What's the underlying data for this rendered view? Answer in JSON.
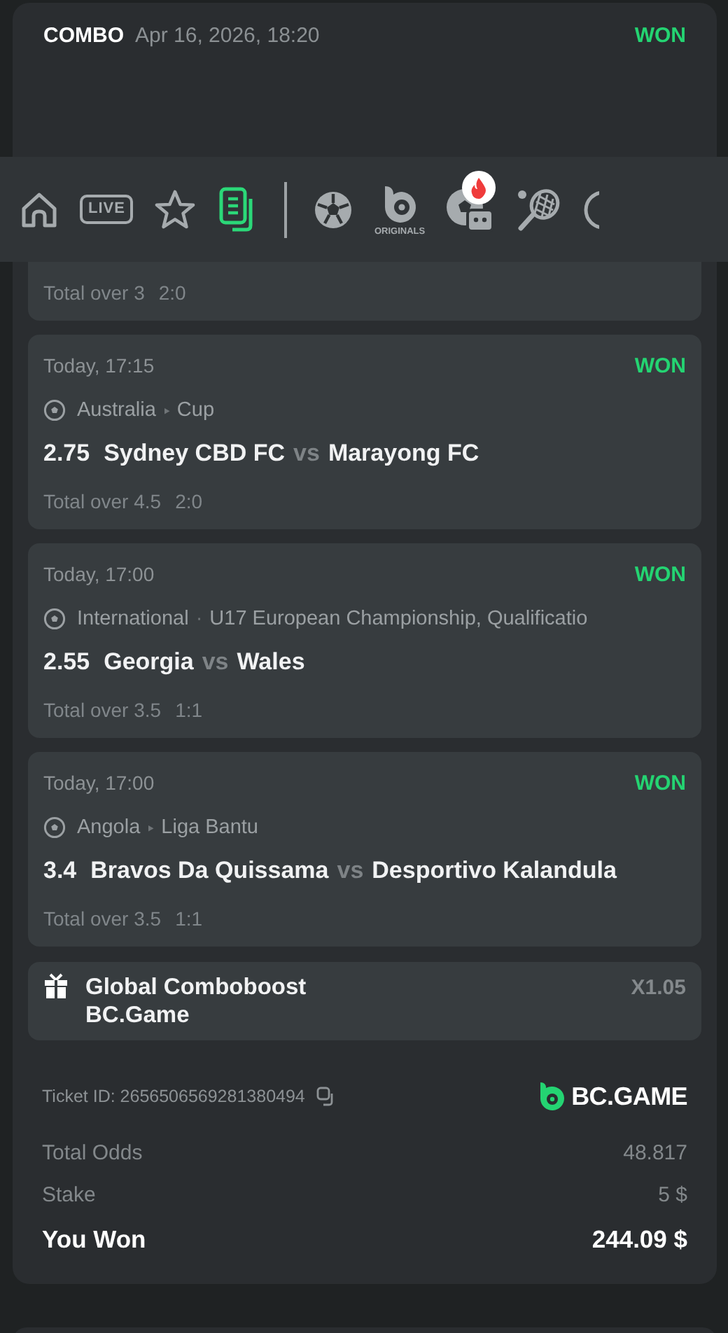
{
  "header": {
    "type": "COMBO",
    "date": "Apr 16, 2026, 18:20",
    "status": "WON"
  },
  "nav": {
    "items": [
      {
        "kind": "home",
        "selected": false
      },
      {
        "kind": "live",
        "label": "LIVE",
        "selected": false
      },
      {
        "kind": "favorites",
        "selected": false
      },
      {
        "kind": "bets",
        "selected": true
      },
      {
        "kind": "divider"
      },
      {
        "kind": "soccer",
        "selected": false
      },
      {
        "kind": "originals",
        "label": "ORIGINALS",
        "selected": false
      },
      {
        "kind": "soccer-bot",
        "hot": true,
        "selected": false
      },
      {
        "kind": "tennis",
        "selected": false
      },
      {
        "kind": "ball",
        "selected": false
      }
    ]
  },
  "legs": [
    {
      "market": "Total over 3",
      "score": "2:0"
    },
    {
      "date": "Today, 17:15",
      "status": "WON",
      "league": [
        "Australia",
        "Cup"
      ],
      "separator": "‣",
      "odds": "2.75",
      "home": "Sydney CBD FC",
      "vs": "vs",
      "away": "Marayong FC",
      "market": "Total over 4.5",
      "score": "2:0"
    },
    {
      "date": "Today, 17:00",
      "status": "WON",
      "league": [
        "International",
        "U17 European Championship, Qualificatio"
      ],
      "separator": "·",
      "odds": "2.55",
      "home": "Georgia",
      "vs": "vs",
      "away": "Wales",
      "market": "Total over 3.5",
      "score": "1:1"
    },
    {
      "date": "Today, 17:00",
      "status": "WON",
      "league": [
        "Angola",
        "Liga Bantu"
      ],
      "separator": "‣",
      "odds": "3.4",
      "home": "Bravos Da Quissama",
      "vs": "vs",
      "away": "Desportivo Kalandula",
      "market": "Total over 3.5",
      "score": "1:1"
    }
  ],
  "boost": {
    "title": "Global Comboboost",
    "subtitle": "BC.Game",
    "multiplier": "X1.05"
  },
  "ticket": {
    "id": "Ticket ID: 2656506569281380494",
    "brand": "BC.GAME"
  },
  "totals": [
    {
      "label": "Total Odds",
      "value": "48.817",
      "kind": "muted"
    },
    {
      "label": "Stake",
      "value": "5 $",
      "kind": "muted"
    },
    {
      "label": "You Won",
      "value": "244.09 $",
      "kind": "result"
    }
  ]
}
